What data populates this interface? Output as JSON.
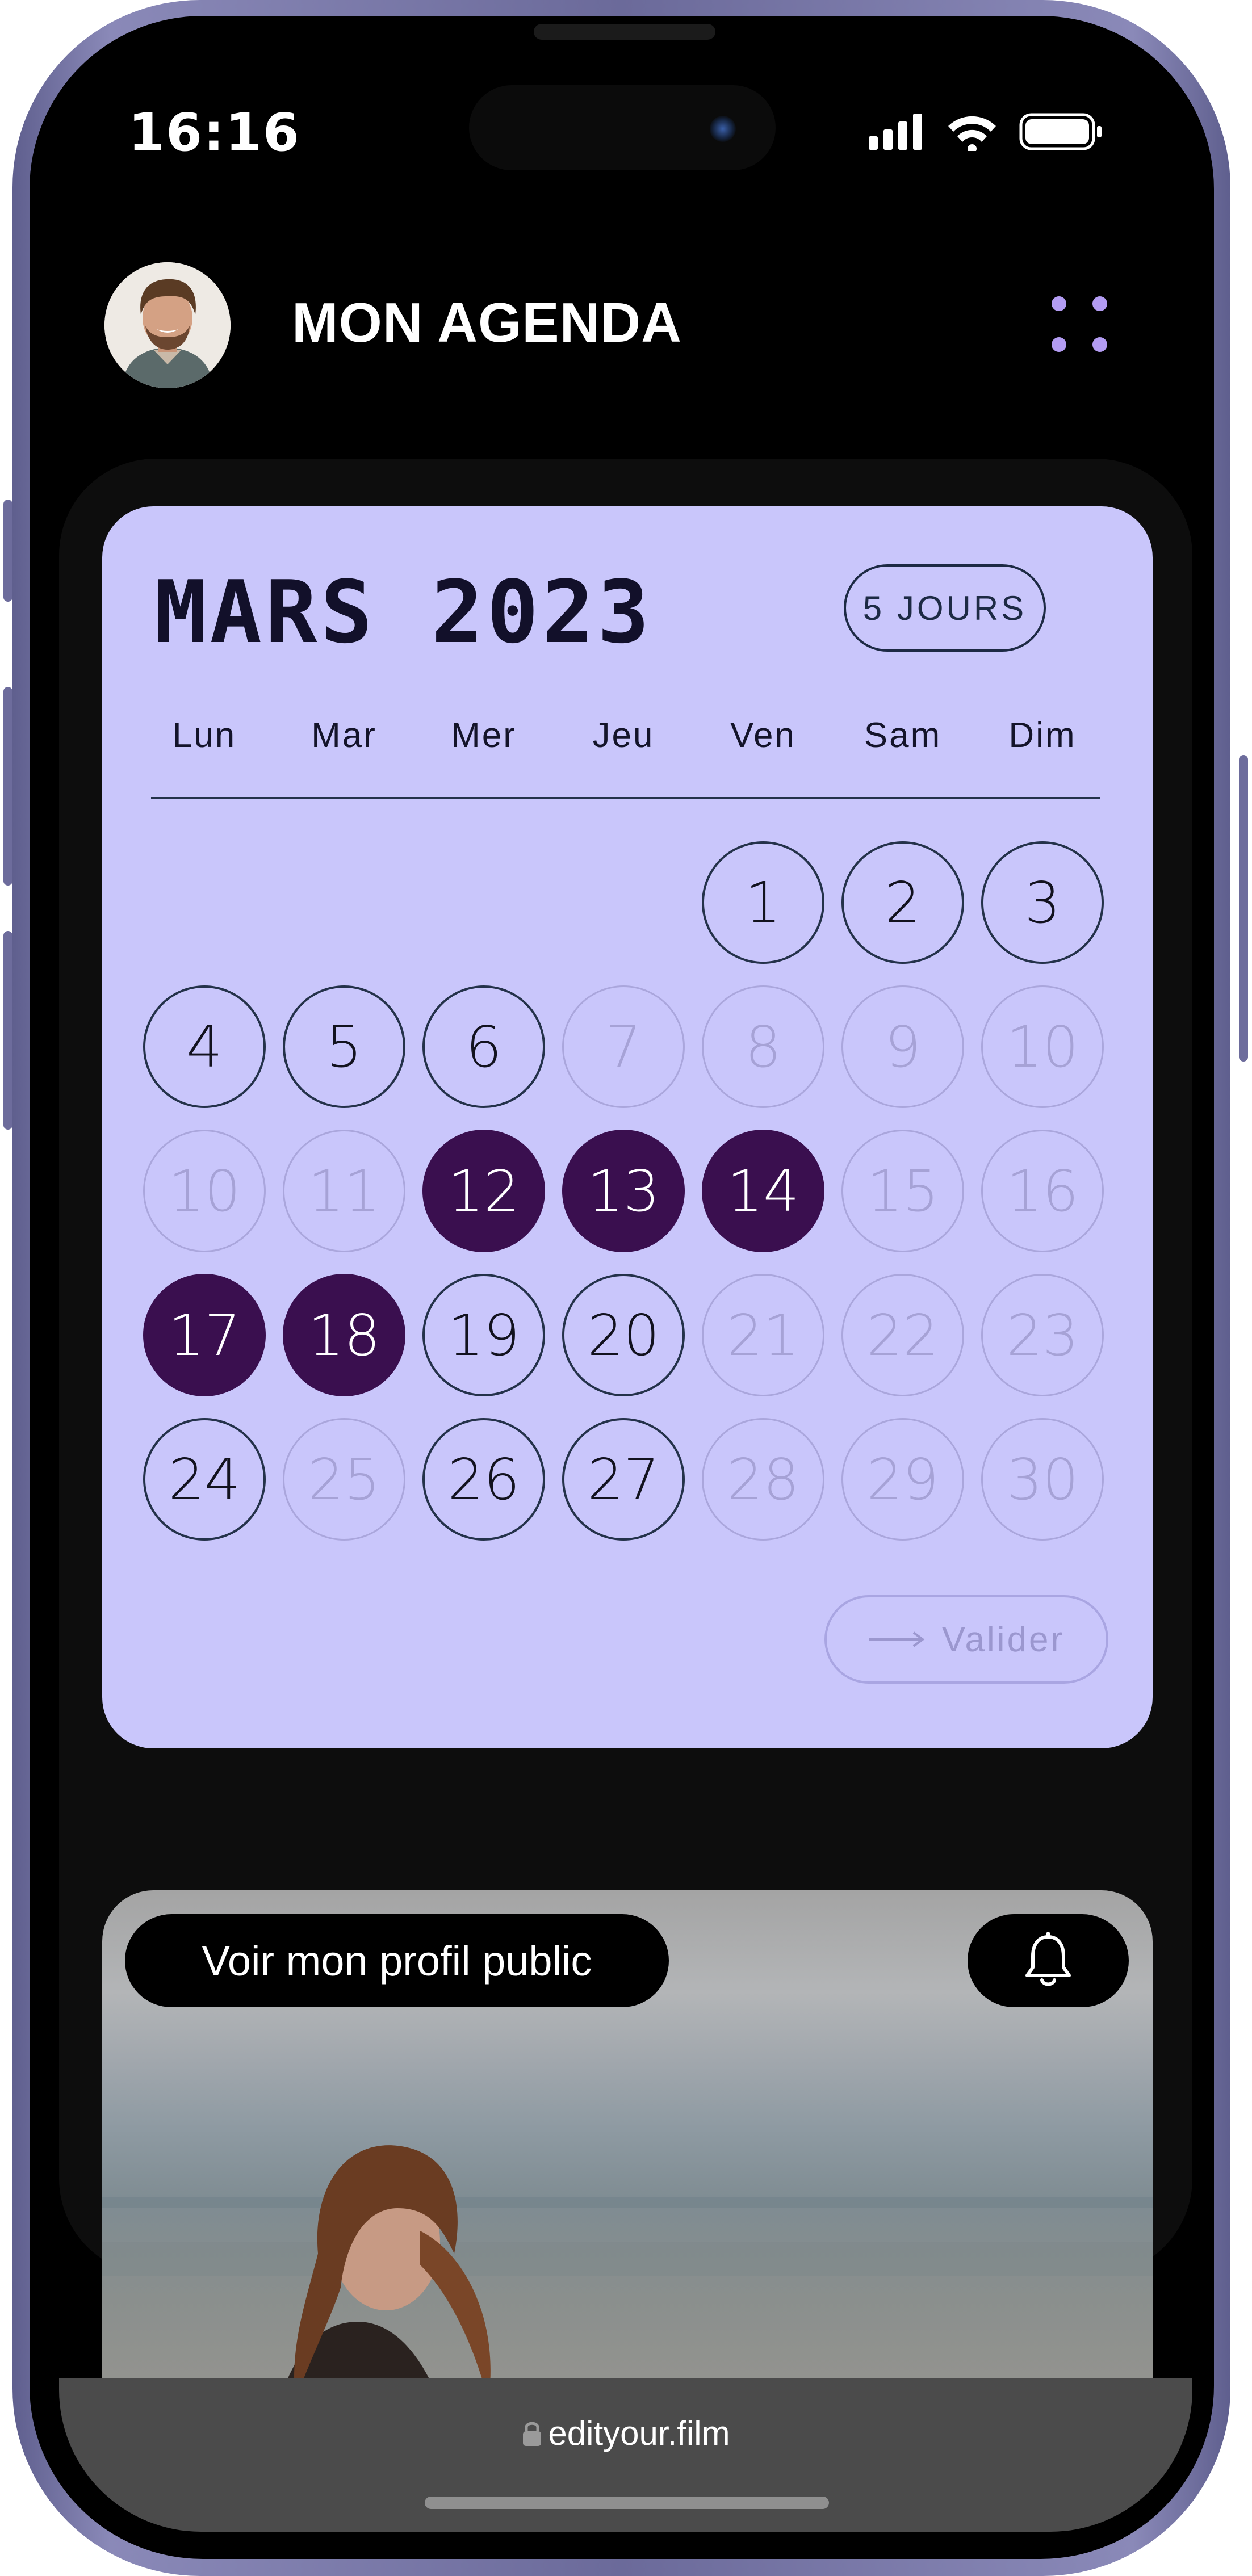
{
  "status_bar": {
    "time": "16:16"
  },
  "header": {
    "title": "MON AGENDA",
    "avatar": "user-avatar",
    "menu_icon": "grid-dots-icon"
  },
  "calendar": {
    "month_title": "MARS 2023",
    "range_button": "5 JOURS",
    "weekdays": [
      "Lun",
      "Mar",
      "Mer",
      "Jeu",
      "Ven",
      "Sam",
      "Dim"
    ],
    "rows": [
      [
        null,
        null,
        null,
        null,
        {
          "d": "1",
          "s": "available"
        },
        {
          "d": "2",
          "s": "available"
        },
        {
          "d": "3",
          "s": "available"
        }
      ],
      [
        {
          "d": "4",
          "s": "available"
        },
        {
          "d": "5",
          "s": "available"
        },
        {
          "d": "6",
          "s": "available"
        },
        {
          "d": "7",
          "s": "disabled"
        },
        {
          "d": "8",
          "s": "disabled"
        },
        {
          "d": "9",
          "s": "disabled"
        },
        {
          "d": "10",
          "s": "disabled"
        }
      ],
      [
        {
          "d": "10",
          "s": "disabled"
        },
        {
          "d": "11",
          "s": "disabled"
        },
        {
          "d": "12",
          "s": "selected"
        },
        {
          "d": "13",
          "s": "selected"
        },
        {
          "d": "14",
          "s": "selected"
        },
        {
          "d": "15",
          "s": "disabled"
        },
        {
          "d": "16",
          "s": "disabled"
        }
      ],
      [
        {
          "d": "17",
          "s": "selected"
        },
        {
          "d": "18",
          "s": "selected"
        },
        {
          "d": "19",
          "s": "available"
        },
        {
          "d": "20",
          "s": "available"
        },
        {
          "d": "21",
          "s": "disabled"
        },
        {
          "d": "22",
          "s": "disabled"
        },
        {
          "d": "23",
          "s": "disabled"
        }
      ],
      [
        {
          "d": "24",
          "s": "available"
        },
        {
          "d": "25",
          "s": "disabled"
        },
        {
          "d": "26",
          "s": "available"
        },
        {
          "d": "27",
          "s": "available"
        },
        {
          "d": "28",
          "s": "disabled"
        },
        {
          "d": "29",
          "s": "disabled"
        },
        {
          "d": "30",
          "s": "disabled"
        }
      ]
    ],
    "validate_button": "Valider",
    "validate_icon": "arrow-right-icon"
  },
  "profile_card": {
    "public_profile_button": "Voir mon profil public",
    "bell_icon": "bell-icon"
  },
  "browser": {
    "url": "edityour.film",
    "lock_icon": "lock-icon"
  },
  "colors": {
    "calendar_bg": "#c9c6fb",
    "selected_day": "#3a0f4f",
    "accent_dots": "#b39cf2",
    "frame": "#7a79aa"
  }
}
